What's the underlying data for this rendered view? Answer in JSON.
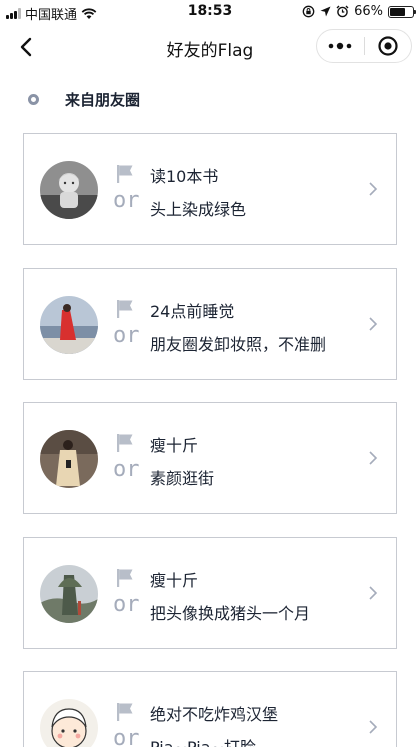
{
  "status_bar": {
    "carrier": "中国联通",
    "time": "18:53",
    "battery_percent": "66%",
    "battery_level": 0.66
  },
  "nav": {
    "title": "好友的Flag"
  },
  "section": {
    "title": "来自朋友圈"
  },
  "or_label": "or",
  "cards": [
    {
      "line1": "读10本书",
      "line2": "头上染成绿色"
    },
    {
      "line1": "24点前睡觉",
      "line2": "朋友圈发卸妆照，不准删"
    },
    {
      "line1": "瘦十斤",
      "line2": "素颜逛街"
    },
    {
      "line1": "瘦十斤",
      "line2": "把头像换成猪头一个月"
    },
    {
      "line1": "绝对不吃炸鸡汉堡",
      "line2": "Pia~Pia~打脸"
    }
  ],
  "colors": {
    "text": "#1c2433",
    "or_gray": "#a5acbb",
    "flag_gray": "#b8bec9",
    "card_border": "#c7cad1"
  }
}
